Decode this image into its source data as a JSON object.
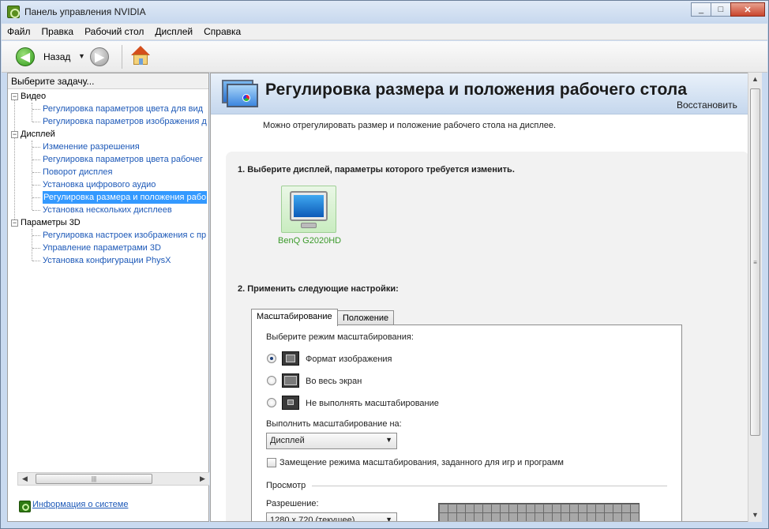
{
  "window": {
    "title": "Панель управления NVIDIA",
    "minimize": "_",
    "maximize": "□",
    "close": "✕"
  },
  "menu": [
    "Файл",
    "Правка",
    "Рабочий стол",
    "Дисплей",
    "Справка"
  ],
  "toolbar": {
    "back_label": "Назад",
    "back_icon": "arrow-left-icon",
    "forward_icon": "arrow-right-icon",
    "home_icon": "home-icon"
  },
  "sidebar": {
    "header": "Выберите задачу...",
    "tree": [
      {
        "label": "Видео",
        "type": "category",
        "expander": "−"
      },
      {
        "label": "Регулировка параметров цвета для вид",
        "type": "link"
      },
      {
        "label": "Регулировка параметров изображения д",
        "type": "link"
      },
      {
        "label": "Дисплей",
        "type": "category",
        "expander": "−"
      },
      {
        "label": "Изменение разрешения",
        "type": "link"
      },
      {
        "label": "Регулировка параметров цвета рабочег",
        "type": "link"
      },
      {
        "label": "Поворот дисплея",
        "type": "link"
      },
      {
        "label": "Установка цифрового аудио",
        "type": "link"
      },
      {
        "label": "Регулировка размера и положения рабо",
        "type": "link",
        "selected": true
      },
      {
        "label": "Установка нескольких дисплеев",
        "type": "link"
      },
      {
        "label": "Параметры 3D",
        "type": "category",
        "expander": "−"
      },
      {
        "label": "Регулировка настроек изображения с пр",
        "type": "link"
      },
      {
        "label": "Управление параметрами 3D",
        "type": "link"
      },
      {
        "label": "Установка конфигурации PhysX",
        "type": "link"
      }
    ],
    "system_info": "Информация о системе"
  },
  "main": {
    "title": "Регулировка размера и положения рабочего стола",
    "restore": "Восстановить",
    "description": "Можно отрегулировать размер и положение рабочего стола на дисплее.",
    "step1": "1. Выберите дисплей, параметры которого требуется изменить.",
    "display_name": "BenQ G2020HD",
    "step2": "2. Применить следующие настройки:",
    "tabs": [
      "Масштабирование",
      "Положение"
    ],
    "scaling_mode_label": "Выберите режим масштабирования:",
    "scaling_options": [
      {
        "label": "Формат изображения",
        "checked": true
      },
      {
        "label": "Во весь экран",
        "checked": false
      },
      {
        "label": "Не выполнять масштабирование",
        "checked": false
      }
    ],
    "perform_on_label": "Выполнить масштабирование на:",
    "perform_on_value": "Дисплей",
    "override_label": "Замещение режима масштабирования, заданного для игр и программ",
    "preview_label": "Просмотр",
    "resolution_label": "Разрешение:",
    "resolution_value": "1280 x 720 (текущее)"
  }
}
